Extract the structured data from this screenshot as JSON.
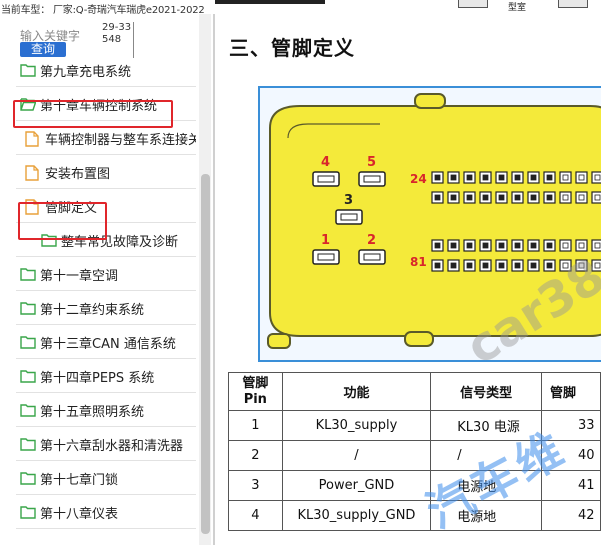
{
  "topbar": {
    "vehicle_info": "当前车型：  厂家:Q-奇瑞汽车瑞虎e2021-2022",
    "right_label": "型室"
  },
  "sidebar": {
    "search_placeholder": "输入关键字",
    "search_value": "29-33548",
    "search_button": "查询",
    "items": [
      {
        "label": "第九章充电系统",
        "icon": "folder-icon"
      },
      {
        "label": "第十章车辆控制系统",
        "icon": "folder-open-icon"
      },
      {
        "label": "车辆控制器与整车系连接关",
        "icon": "document-icon"
      },
      {
        "label": "安装布置图",
        "icon": "document-icon"
      },
      {
        "label": "管脚定义",
        "icon": "document-icon"
      },
      {
        "label": "整车常见故障及诊断",
        "icon": "folder-icon"
      },
      {
        "label": "第十一章空调",
        "icon": "folder-icon"
      },
      {
        "label": "第十二章约束系统",
        "icon": "folder-icon"
      },
      {
        "label": "第十三章CAN 通信系统",
        "icon": "folder-icon"
      },
      {
        "label": "第十四章PEPS 系统",
        "icon": "folder-icon"
      },
      {
        "label": "第十五章照明系统",
        "icon": "folder-icon"
      },
      {
        "label": "第十六章刮水器和清洗器",
        "icon": "folder-icon"
      },
      {
        "label": "第十七章门锁",
        "icon": "folder-icon"
      },
      {
        "label": "第十八章仪表",
        "icon": "folder-icon"
      }
    ]
  },
  "main": {
    "section_title": "三、管脚定义",
    "diagram": {
      "pin_numbers": [
        "4",
        "5",
        "3",
        "1",
        "2",
        "24",
        "81"
      ]
    },
    "table": {
      "headers": [
        "管脚\nPin",
        "功能",
        "信号类型",
        "管脚"
      ],
      "rows": [
        [
          "1",
          "KL30_supply",
          "KL30 电源",
          "33"
        ],
        [
          "2",
          "/",
          "/",
          "40"
        ],
        [
          "3",
          "Power_GND",
          "电源地",
          "41"
        ],
        [
          "4",
          "KL30_supply_GND",
          "电源地",
          "42"
        ]
      ]
    },
    "watermarks": [
      "car38",
      "汽车维"
    ]
  },
  "colors": {
    "highlight": "#e0262b",
    "folder": "#3aa64a",
    "document": "#e8a13a",
    "search_button": "#2b6fd1",
    "connector": "#f4ea3a",
    "pin_red": "#d8262b"
  }
}
